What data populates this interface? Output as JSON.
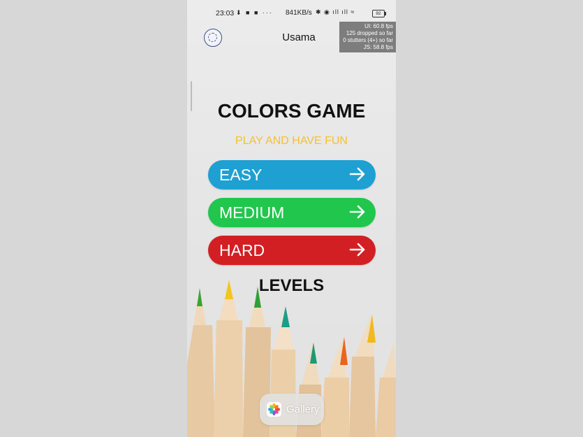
{
  "statusbar": {
    "time": "23:03",
    "left_icons": "⬇ ■ ■ ···",
    "speed": "841KB/s",
    "right_icons": "✱ ◉ ıll ıll ≈",
    "battery": "92"
  },
  "header": {
    "username": "Usama"
  },
  "perf_overlay": {
    "line1": "UI: 60.8 fps",
    "line2": "125 dropped so far",
    "line3": "0 stutters (4+) so far",
    "line4": "JS: 58.8 fps"
  },
  "main": {
    "title": "COLORS GAME",
    "subtitle": "PLAY AND HAVE FUN",
    "levels": [
      {
        "label": "EASY",
        "color": "#1ea0d3"
      },
      {
        "label": "MEDIUM",
        "color": "#21c74c"
      },
      {
        "label": "HARD",
        "color": "#d21f23"
      }
    ],
    "levels_heading": "LEVELS"
  },
  "gallery": {
    "label": "Gallery"
  }
}
